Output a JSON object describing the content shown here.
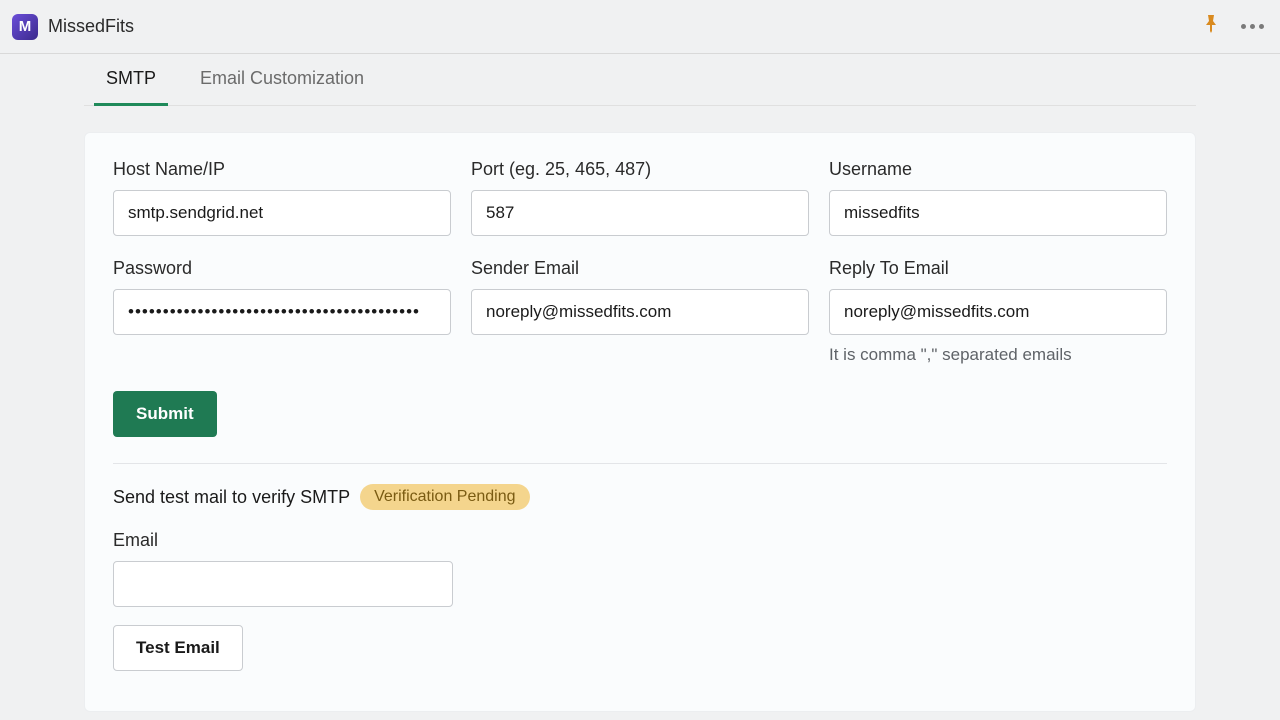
{
  "app": {
    "title": "MissedFits",
    "iconLetter": "M"
  },
  "tabs": {
    "smtp": "SMTP",
    "emailCustomization": "Email Customization"
  },
  "form": {
    "host": {
      "label": "Host Name/IP",
      "value": "smtp.sendgrid.net"
    },
    "port": {
      "label": "Port (eg. 25, 465, 487)",
      "value": "587"
    },
    "username": {
      "label": "Username",
      "value": "missedfits"
    },
    "password": {
      "label": "Password",
      "value": "••••••••••••••••••••••••••••••••••••••••••"
    },
    "senderEmail": {
      "label": "Sender Email",
      "value": "noreply@missedfits.com"
    },
    "replyTo": {
      "label": "Reply To Email",
      "value": "noreply@missedfits.com",
      "hint": "It is comma \",\" separated emails"
    },
    "submit": "Submit"
  },
  "test": {
    "heading": "Send test mail to verify SMTP",
    "badge": "Verification Pending",
    "emailLabel": "Email",
    "emailValue": "",
    "button": "Test Email"
  }
}
